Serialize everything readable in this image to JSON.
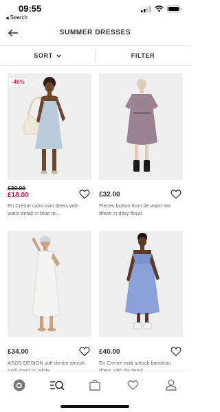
{
  "status_bar": {
    "time": "09:55",
    "back_label": "Search"
  },
  "header": {
    "title": "SUMMER DRESSES"
  },
  "toolbar": {
    "sort_label": "SORT",
    "filter_label": "FILTER"
  },
  "products": [
    {
      "badge": "-40%",
      "old_price": "£30.00",
      "price": "£18.00",
      "name": "En Crème cami mini dress with waist detail in blue mi...",
      "dress_color": "#b9cbd9"
    },
    {
      "badge": "",
      "old_price": "",
      "price": "£32.00",
      "name": "Pieces button front tie waist tea dress in ditsy floral",
      "dress_color": "#9a8390"
    },
    {
      "badge": "",
      "old_price": "",
      "price": "£34.00",
      "name": "ASOS DESIGN soft denim smock midi dress in white",
      "dress_color": "#f4f4f2"
    },
    {
      "badge": "",
      "old_price": "",
      "price": "£40.00",
      "name": "En Crème midi smock bandeau dress with tie detail",
      "dress_color": "#8aa0d8"
    }
  ],
  "bottom_nav": [
    {
      "icon": "asos-home-icon"
    },
    {
      "icon": "search-list-icon"
    },
    {
      "icon": "bag-icon"
    },
    {
      "icon": "saved-heart-icon"
    },
    {
      "icon": "account-icon"
    }
  ],
  "colors": {
    "sale": "#d01345",
    "text": "#2d2d2d",
    "muted": "#666666"
  }
}
